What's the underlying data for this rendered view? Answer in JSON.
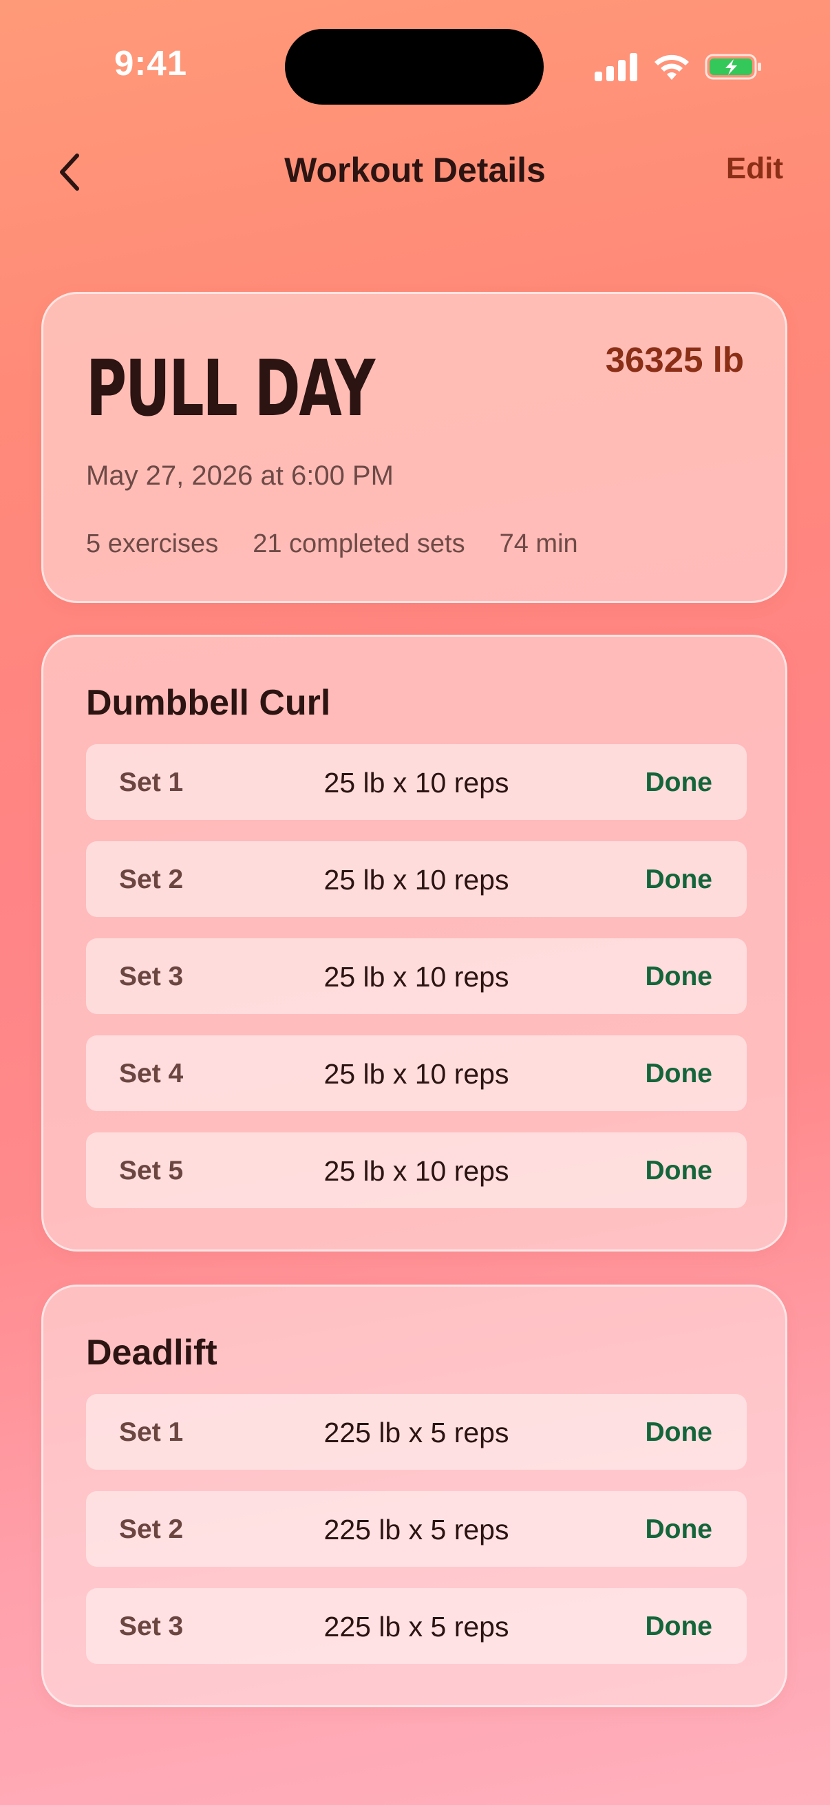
{
  "status_bar": {
    "time": "9:41"
  },
  "nav": {
    "title": "Workout Details",
    "edit_label": "Edit",
    "back_icon": "chevron-left-icon"
  },
  "summary": {
    "title": "PULL DAY",
    "total_volume": "36325 lb",
    "date": "May 27, 2026 at 6:00 PM",
    "stats": [
      "5 exercises",
      "21 completed sets",
      "74 min"
    ]
  },
  "exercises": [
    {
      "name": "Dumbbell Curl",
      "sets": [
        {
          "label": "Set 1",
          "detail": "25 lb x 10 reps",
          "status": "Done"
        },
        {
          "label": "Set 2",
          "detail": "25 lb x 10 reps",
          "status": "Done"
        },
        {
          "label": "Set 3",
          "detail": "25 lb x 10 reps",
          "status": "Done"
        },
        {
          "label": "Set 4",
          "detail": "25 lb x 10 reps",
          "status": "Done"
        },
        {
          "label": "Set 5",
          "detail": "25 lb x 10 reps",
          "status": "Done"
        }
      ]
    },
    {
      "name": "Deadlift",
      "sets": [
        {
          "label": "Set 1",
          "detail": "225 lb x 5 reps",
          "status": "Done"
        },
        {
          "label": "Set 2",
          "detail": "225 lb x 5 reps",
          "status": "Done"
        },
        {
          "label": "Set 3",
          "detail": "225 lb x 5 reps",
          "status": "Done"
        }
      ]
    }
  ],
  "colors": {
    "accent": "#8a2e16",
    "done": "#14653a",
    "battery_fill": "#34c759"
  }
}
